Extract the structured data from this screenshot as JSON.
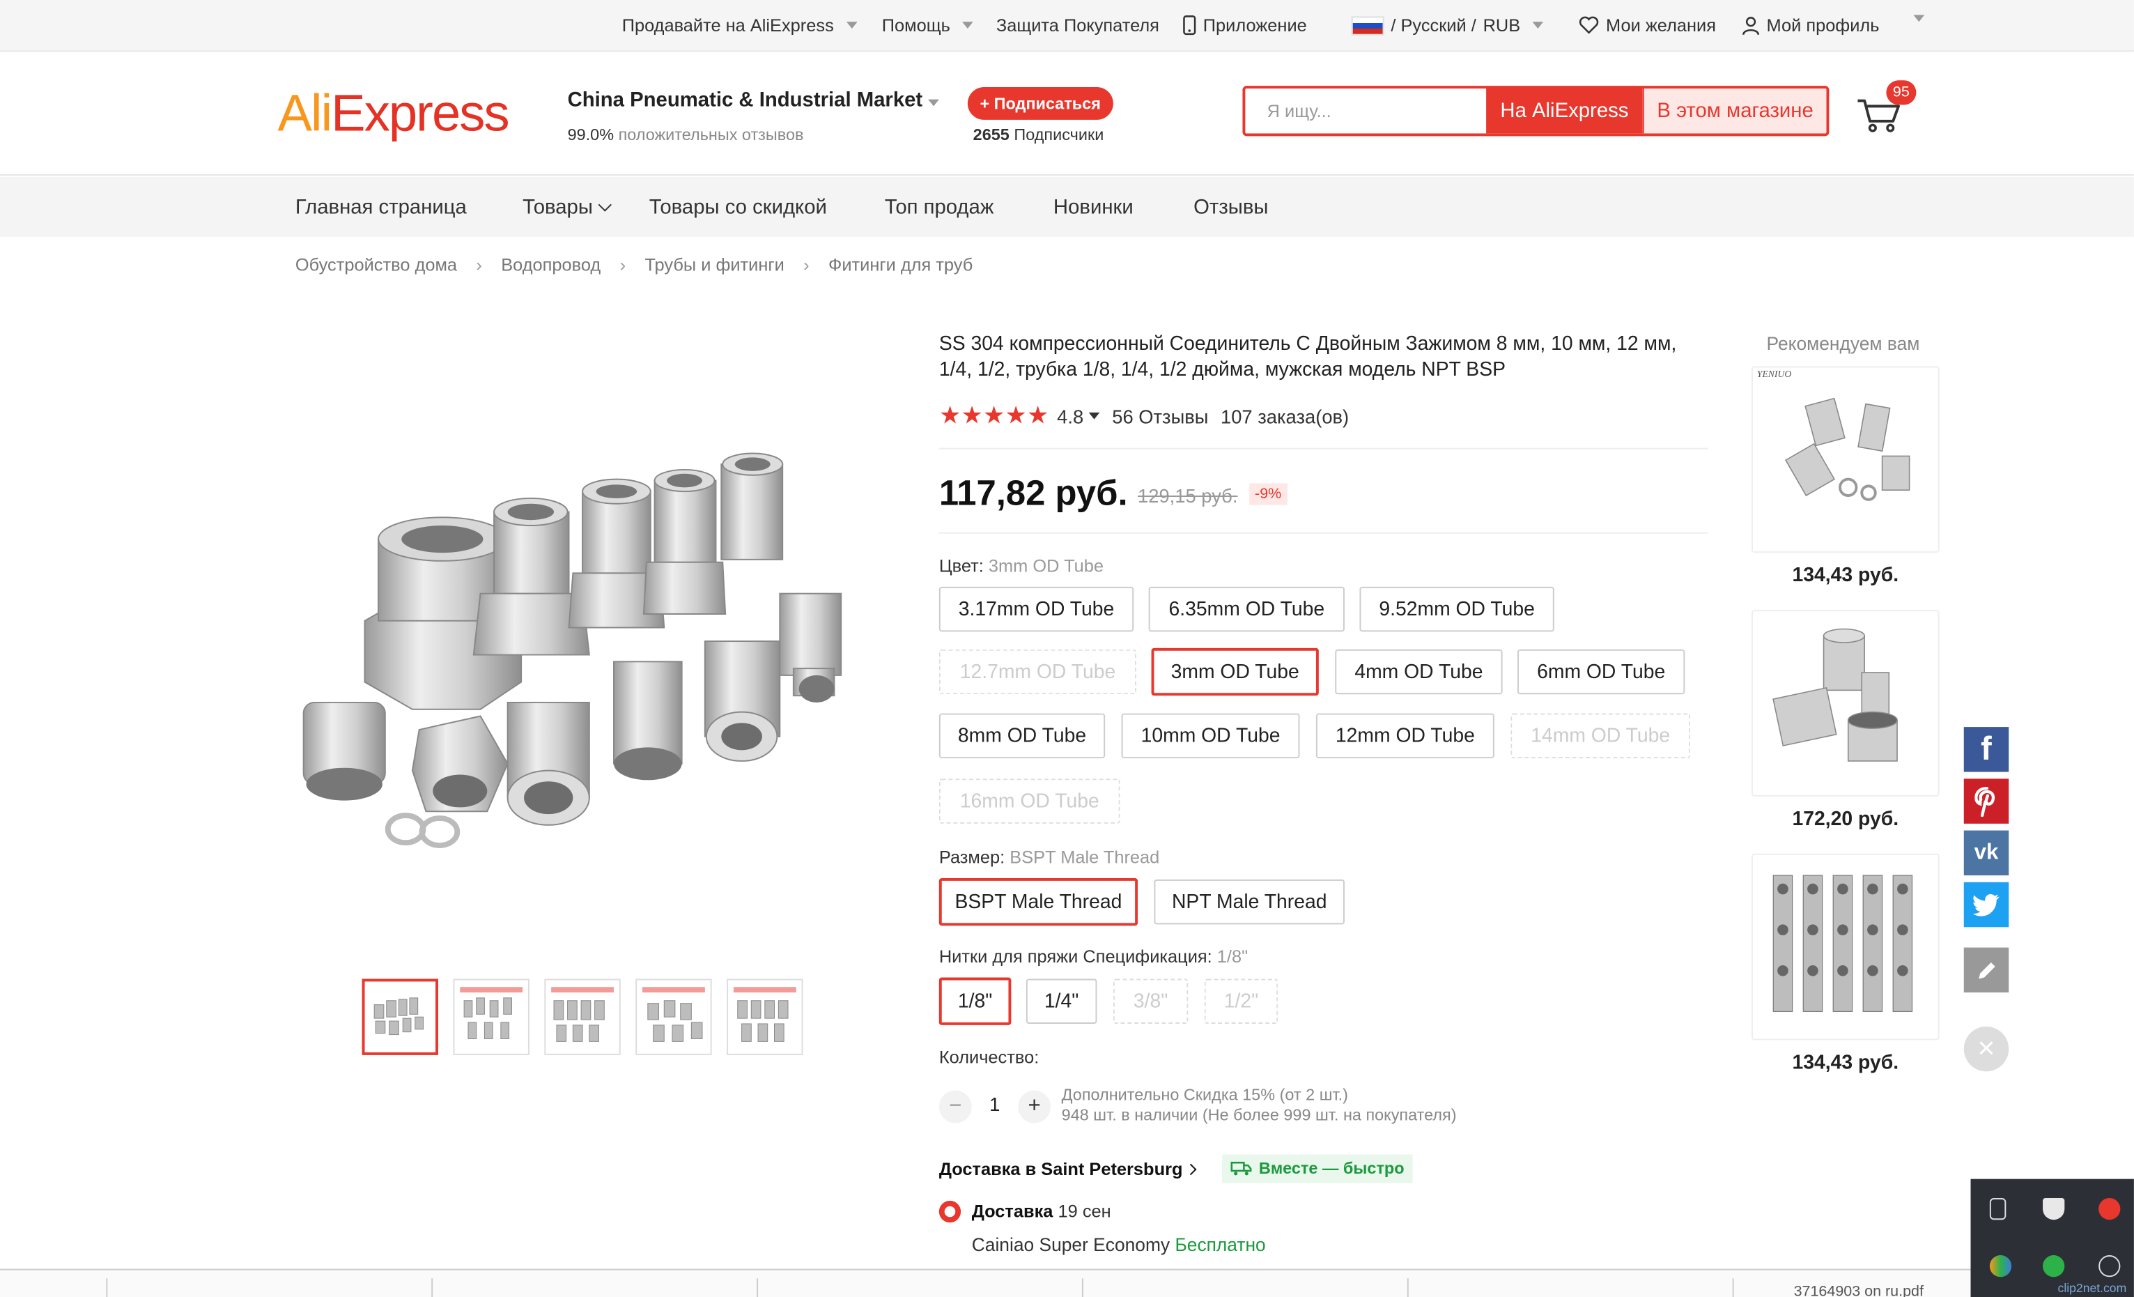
{
  "topbar": {
    "sell": "Продавайте на AliExpress",
    "help": "Помощь",
    "protection": "Защита Покупателя",
    "app": "Приложение",
    "lang": "/ Русский /",
    "currency": "RUB",
    "wishlist": "Мои желания",
    "profile": "Мой профиль"
  },
  "header": {
    "logo_a": "Ali",
    "logo_b": "Express",
    "store_name": "China Pneumatic & Industrial Market",
    "feedback_pct": "99.0%",
    "feedback_text": "положительных отзывов",
    "subscribe": "+ Подписаться",
    "subscribers_count": "2655",
    "subscribers_text": "Подписчики",
    "search_placeholder": "Я ищу...",
    "search_ae": "На AliExpress",
    "search_store": "В этом магазине",
    "cart_count": "95"
  },
  "nav": [
    "Главная страница",
    "Товары",
    "Товары со скидкой",
    "Топ продаж",
    "Новинки",
    "Отзывы"
  ],
  "breadcrumb": [
    "Обустройство дома",
    "Водопровод",
    "Трубы и фитинги",
    "Фитинги для труб"
  ],
  "product": {
    "title": "SS 304 компрессионный Соединитель С Двойным Зажимом 8 мм, 10 мм, 12 мм, 1/4, 1/2, трубка 1/8, 1/4, 1/2 дюйма, мужская модель NPT BSP",
    "rating": "4.8",
    "reviews": "56 Отзывы",
    "orders": "107 заказа(ов)",
    "price": "117,82 руб.",
    "old_price": "129,15 руб.",
    "discount": "-9%",
    "color_label": "Цвет:",
    "color_selected": "3mm OD Tube",
    "colors": [
      {
        "label": "3.17mm OD Tube",
        "state": "normal"
      },
      {
        "label": "6.35mm OD Tube",
        "state": "normal"
      },
      {
        "label": "9.52mm OD Tube",
        "state": "normal"
      },
      {
        "label": "12.7mm OD Tube",
        "state": "disabled"
      },
      {
        "label": "3mm OD Tube",
        "state": "selected"
      },
      {
        "label": "4mm OD Tube",
        "state": "normal"
      },
      {
        "label": "6mm OD Tube",
        "state": "normal"
      },
      {
        "label": "8mm OD Tube",
        "state": "normal"
      },
      {
        "label": "10mm OD Tube",
        "state": "normal"
      },
      {
        "label": "12mm OD Tube",
        "state": "normal"
      },
      {
        "label": "14mm OD Tube",
        "state": "disabled"
      },
      {
        "label": "16mm OD Tube",
        "state": "disabled"
      }
    ],
    "size_label": "Размер:",
    "size_selected": "BSPT Male Thread",
    "sizes": [
      {
        "label": "BSPT Male Thread",
        "state": "selected"
      },
      {
        "label": "NPT Male Thread",
        "state": "normal"
      }
    ],
    "thread_label": "Нитки для пряжи Спецификация:",
    "thread_selected": "1/8\"",
    "threads": [
      {
        "label": "1/8\"",
        "state": "selected"
      },
      {
        "label": "1/4\"",
        "state": "normal"
      },
      {
        "label": "3/8\"",
        "state": "disabled"
      },
      {
        "label": "1/2\"",
        "state": "disabled"
      }
    ],
    "qty_label": "Количество:",
    "qty": "1",
    "qty_minus": "−",
    "qty_plus": "+",
    "qty_discount": "Дополнительно Скидка 15% (от 2 шт.)",
    "qty_stock": "948 шт. в наличии (Не более 999 шт. на покупателя)",
    "ship_to": "Доставка в Saint Petersburg",
    "together": "Вместе — быстро",
    "delivery_label": "Доставка",
    "delivery_date": "19 сен",
    "carrier": "Cainiao Super Economy",
    "carrier_price": "Бесплатно"
  },
  "recommend": {
    "title": "Рекомендуем вам",
    "brand": "YENIUO",
    "prices": [
      "134,43 руб.",
      "172,20 руб.",
      "134,43 руб."
    ]
  },
  "share_icons": [
    "facebook-icon",
    "pinterest-icon",
    "vk-icon",
    "twitter-icon",
    "edit-icon"
  ],
  "footer": {
    "file": "37164903 on ru.pdf",
    "watermark": "clip2net.com"
  },
  "colors": {
    "accent": "#e8372d",
    "logo_orange": "#f7971e",
    "green": "#1a9a3c",
    "facebook": "#3b5998",
    "pinterest": "#cb2027",
    "vk": "#4c75a3",
    "twitter": "#1da1f2"
  }
}
